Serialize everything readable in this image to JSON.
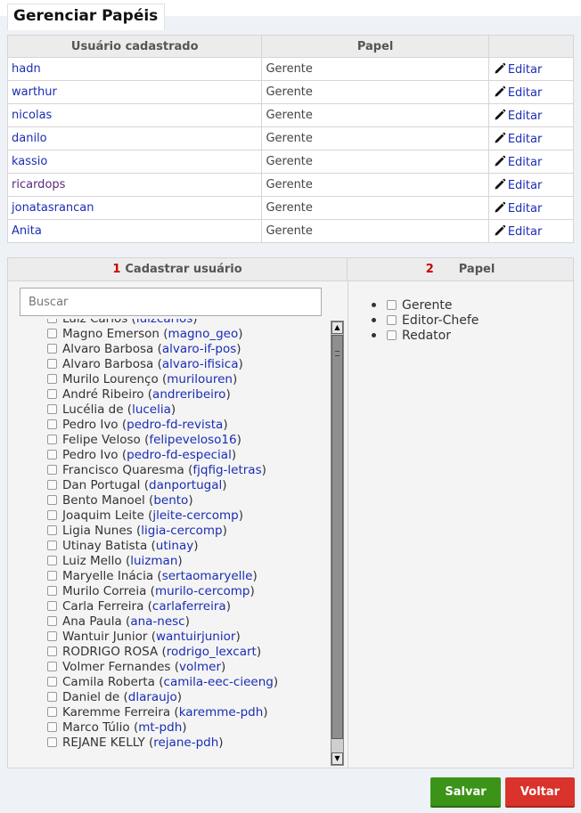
{
  "page": {
    "title": "Gerenciar Papéis"
  },
  "users_table": {
    "headers": [
      "Usuário cadastrado",
      "Papel",
      ""
    ],
    "edit_label": "Editar",
    "rows": [
      {
        "user": "hadn",
        "role": "Gerente"
      },
      {
        "user": "warthur",
        "role": "Gerente"
      },
      {
        "user": "nicolas",
        "role": "Gerente"
      },
      {
        "user": "danilo",
        "role": "Gerente"
      },
      {
        "user": "kassio",
        "role": "Gerente"
      },
      {
        "user": "ricardops",
        "role": "Gerente"
      },
      {
        "user": "jonatasrancan",
        "role": "Gerente"
      },
      {
        "user": "Anita",
        "role": "Gerente"
      }
    ]
  },
  "assign_panel": {
    "step1_number": "1",
    "step1_label": "Cadastrar usuário",
    "step2_number": "2",
    "step2_label": "Papel",
    "search_placeholder": "Buscar",
    "users": [
      {
        "name": "Luiz Carlos",
        "login": "luizcarlos"
      },
      {
        "name": "Magno Emerson",
        "login": "magno_geo"
      },
      {
        "name": "Alvaro Barbosa",
        "login": "alvaro-if-pos"
      },
      {
        "name": "Alvaro Barbosa",
        "login": "alvaro-ifisica"
      },
      {
        "name": "Murilo Lourenço",
        "login": "murilouren"
      },
      {
        "name": "André Ribeiro",
        "login": "andreribeiro"
      },
      {
        "name": "Lucélia de",
        "login": "lucelia"
      },
      {
        "name": "Pedro Ivo",
        "login": "pedro-fd-revista"
      },
      {
        "name": "Felipe Veloso",
        "login": "felipeveloso16"
      },
      {
        "name": "Pedro Ivo",
        "login": "pedro-fd-especial"
      },
      {
        "name": "Francisco Quaresma",
        "login": "fjqfig-letras"
      },
      {
        "name": "Dan Portugal",
        "login": "danportugal"
      },
      {
        "name": "Bento Manoel",
        "login": "bento"
      },
      {
        "name": "Joaquim Leite",
        "login": "jleite-cercomp"
      },
      {
        "name": "Ligia Nunes",
        "login": "ligia-cercomp"
      },
      {
        "name": "Utinay Batista",
        "login": "utinay"
      },
      {
        "name": "Luiz Mello",
        "login": "luizman"
      },
      {
        "name": "Maryelle Inácia",
        "login": "sertaomaryelle"
      },
      {
        "name": "Murilo Correia",
        "login": "murilo-cercomp"
      },
      {
        "name": "Carla Ferreira",
        "login": "carlaferreira"
      },
      {
        "name": "Ana Paula",
        "login": "ana-nesc"
      },
      {
        "name": "Wantuir Junior",
        "login": "wantuirjunior"
      },
      {
        "name": "RODRIGO ROSA",
        "login": "rodrigo_lexcart"
      },
      {
        "name": "Volmer Fernandes",
        "login": "volmer"
      },
      {
        "name": "Camila Roberta",
        "login": "camila-eec-cieeng"
      },
      {
        "name": "Daniel de",
        "login": "dlaraujo"
      },
      {
        "name": "Karemme Ferreira",
        "login": "karemme-pdh"
      },
      {
        "name": "Marco Túlio",
        "login": "mt-pdh"
      },
      {
        "name": "REJANE KELLY",
        "login": "rejane-pdh"
      }
    ],
    "roles": [
      "Gerente",
      "Editor-Chefe",
      "Redator"
    ]
  },
  "actions": {
    "save_label": "Salvar",
    "back_label": "Voltar"
  },
  "colors": {
    "link": "#1a2db3",
    "save": "#3b9417",
    "back": "#d9332b",
    "step_number": "#cc0000"
  },
  "icons": {
    "edit": "pencil-icon",
    "scroll_up": "arrow-up-icon",
    "scroll_down": "arrow-down-icon"
  }
}
